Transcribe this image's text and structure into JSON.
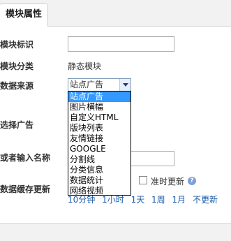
{
  "tabs": [
    {
      "label": "模块属性"
    }
  ],
  "form": {
    "module_id_label": "模块标识",
    "module_id_value": "",
    "module_category_label": "模块分类",
    "module_category_value": "静态模块",
    "data_source_label": "数据来源",
    "data_source_selected": "站点广告",
    "data_source_options": [
      "站点广告",
      "图片横幅",
      "自定义HTML",
      "版块列表",
      "友情链接",
      "GOOGLE",
      "分割线",
      "分类信息",
      "数据统计",
      "网络视频"
    ],
    "select_ad_label": "选择广告",
    "or_input_name_label": "或者输入名称",
    "or_input_name_value": "",
    "cache_update_label": "数据缓存更新",
    "cache_on_time_label": "准时更新",
    "cache_intervals": [
      "10分钟",
      "1小时",
      "1天",
      "1周",
      "1月",
      "不更新"
    ]
  },
  "icons": {
    "dropdown_arrow": "chevron-down-icon",
    "help": "help-icon"
  }
}
